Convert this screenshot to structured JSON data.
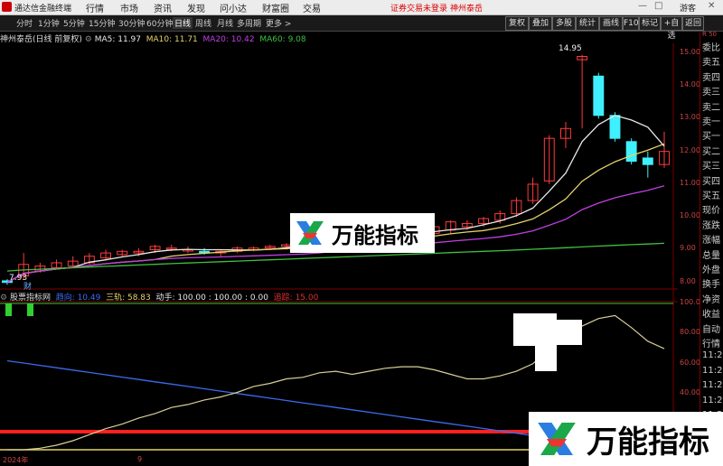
{
  "app": {
    "title": "通达信金融终端",
    "menu": [
      "行情",
      "市场",
      "资讯",
      "发现",
      "问小达",
      "财富圈",
      "交易"
    ],
    "notice": "证券交易未登录",
    "stock_tab": "神州泰岳",
    "guest": "游客",
    "window_controls": [
      "—",
      "□",
      "✕"
    ]
  },
  "periods": {
    "items": [
      "分时",
      "1分钟",
      "5分钟",
      "15分钟",
      "30分钟",
      "60分钟",
      "日线",
      "周线",
      "月线",
      "多周期",
      "更多 >"
    ],
    "active": "日线"
  },
  "toolbar": [
    "复权",
    "叠加",
    "多股",
    "统计",
    "画线",
    "F10",
    "标记",
    "+自选",
    "返回"
  ],
  "main_info": {
    "stock": "神州泰岳(日线 前复权)",
    "ma": [
      {
        "label": "MA5: 11.97",
        "color": "#e8e8e8"
      },
      {
        "label": "MA10: 11.71",
        "color": "#e6d36a"
      },
      {
        "label": "MA20: 10.42",
        "color": "#c040e0"
      },
      {
        "label": "MA60: 9.08",
        "color": "#40c040"
      }
    ]
  },
  "price_axis": [
    "15.00",
    "14.00",
    "13.00",
    "12.00",
    "11.00",
    "10.00",
    "9.00",
    "8.00"
  ],
  "annotations": {
    "high": "14.95",
    "low": "7.93",
    "marker": "财"
  },
  "sub_info": {
    "name": "股票指标网",
    "items": [
      {
        "label": "趋向: 10.49",
        "color": "#3a6cf0"
      },
      {
        "label": "三轨: 58.83",
        "color": "#e6d36a"
      },
      {
        "label": "动手: 100.00 : 100.00 : 0.00",
        "color": "#e6e6e6"
      },
      {
        "label": "追踪: 15.00",
        "color": "#e03030"
      }
    ]
  },
  "sub_axis": [
    "100.0",
    "80.00",
    "60.00",
    "40.00",
    "20.00"
  ],
  "x_axis": {
    "year": "2024年",
    "month": "9"
  },
  "right_panel": {
    "top": "R 50",
    "labels": [
      "委比",
      "卖五",
      "卖四",
      "卖三",
      "卖二",
      "卖一",
      "买一",
      "买二",
      "买三",
      "买四",
      "买五",
      "现价",
      "涨跌",
      "涨幅",
      "总量",
      "外盘",
      "换手",
      "净资",
      "收益",
      "自动",
      "行情",
      "11:2",
      "11:2",
      "11:2",
      "11:2",
      "11:2",
      "11:2",
      "11:2"
    ]
  },
  "watermark": {
    "text": "万能指标"
  },
  "chart_data": {
    "type": "candlestick",
    "series": [
      {
        "name": "K线",
        "ohlc": [
          [
            8.05,
            8.1,
            7.93,
            8.0
          ],
          [
            8.2,
            8.9,
            8.1,
            8.55
          ],
          [
            8.35,
            8.6,
            8.3,
            8.5
          ],
          [
            8.45,
            8.7,
            8.4,
            8.6
          ],
          [
            8.5,
            8.8,
            8.45,
            8.65
          ],
          [
            8.6,
            8.9,
            8.55,
            8.8
          ],
          [
            8.75,
            9.0,
            8.7,
            8.9
          ],
          [
            8.85,
            9.0,
            8.8,
            8.95
          ],
          [
            8.9,
            9.05,
            8.8,
            8.95
          ],
          [
            9.0,
            9.15,
            8.9,
            9.1
          ],
          [
            9.05,
            9.15,
            8.95,
            9.05
          ],
          [
            9.0,
            9.1,
            8.9,
            9.0
          ],
          [
            8.95,
            9.05,
            8.85,
            8.9
          ],
          [
            8.9,
            9.0,
            8.8,
            8.95
          ],
          [
            8.95,
            9.1,
            8.9,
            9.05
          ],
          [
            9.0,
            9.1,
            8.95,
            9.05
          ],
          [
            9.05,
            9.15,
            9.0,
            9.1
          ],
          [
            9.1,
            9.2,
            9.0,
            9.15
          ],
          [
            9.15,
            9.3,
            9.1,
            9.25
          ],
          [
            9.2,
            9.6,
            9.15,
            9.5
          ],
          [
            9.1,
            9.3,
            9.0,
            9.2
          ],
          [
            9.2,
            9.35,
            9.1,
            9.3
          ],
          [
            9.3,
            9.6,
            9.25,
            9.55
          ],
          [
            9.45,
            9.7,
            9.3,
            9.6
          ],
          [
            9.1,
            9.5,
            9.05,
            9.4
          ],
          [
            9.4,
            9.6,
            9.3,
            9.5
          ],
          [
            9.5,
            9.8,
            9.4,
            9.7
          ],
          [
            9.6,
            9.9,
            9.5,
            9.85
          ],
          [
            9.7,
            9.9,
            9.6,
            9.8
          ],
          [
            9.8,
            10.0,
            9.7,
            9.95
          ],
          [
            9.9,
            10.2,
            9.8,
            10.1
          ],
          [
            10.1,
            10.6,
            10.0,
            10.5
          ],
          [
            10.5,
            11.2,
            10.4,
            11.0
          ],
          [
            11.1,
            12.5,
            11.0,
            12.4
          ],
          [
            12.4,
            12.9,
            12.1,
            12.7
          ],
          [
            14.8,
            14.95,
            12.7,
            14.9
          ],
          [
            14.3,
            14.4,
            13.0,
            13.1
          ],
          [
            13.1,
            13.2,
            12.3,
            12.4
          ],
          [
            12.3,
            12.4,
            11.6,
            11.7
          ],
          [
            11.8,
            12.0,
            11.2,
            11.6
          ],
          [
            11.6,
            12.6,
            11.5,
            12.0
          ]
        ]
      }
    ],
    "ylim": [
      7.8,
      15.3
    ]
  }
}
